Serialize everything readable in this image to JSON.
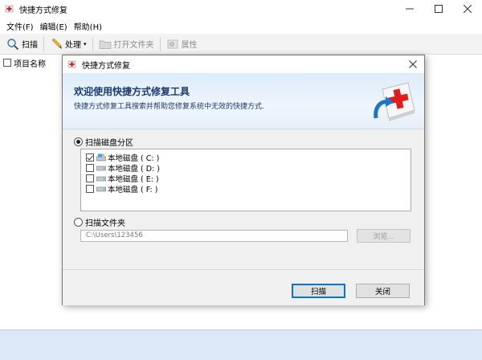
{
  "window": {
    "title": "快捷方式修复",
    "controls": [
      "minimize",
      "maximize",
      "close"
    ]
  },
  "menu": {
    "items": [
      "文件(F)",
      "编辑(E)",
      "帮助(H)"
    ]
  },
  "toolbar": {
    "scan_label": "扫描",
    "process_label": "处理",
    "open_folder_label": "打开文件夹",
    "properties_label": "属性"
  },
  "list": {
    "column_header": "项目名称"
  },
  "dialog": {
    "title": "快捷方式修复",
    "banner_title": "欢迎使用快捷方式修复工具",
    "banner_subtitle": "快捷方式修复工具搜索并帮助您修复系统中无效的快捷方式.",
    "scan_partition_label": "扫描磁盘分区",
    "scan_partition_selected": true,
    "drives": [
      {
        "label": "本地磁盘 ( C: )",
        "checked": true
      },
      {
        "label": "本地磁盘 ( D: )",
        "checked": false
      },
      {
        "label": "本地磁盘 ( E: )",
        "checked": false
      },
      {
        "label": "本地磁盘 ( F: )",
        "checked": false
      }
    ],
    "scan_folder_label": "扫描文件夹",
    "scan_folder_selected": false,
    "folder_path": "C:\\Users\\123456",
    "browse_label": "浏览...",
    "scan_button": "扫描",
    "close_button": "关闭"
  },
  "colors": {
    "status_bar": "#dbe8f8",
    "banner_title": "#1b3a6e",
    "primary_border": "#0078d7"
  }
}
